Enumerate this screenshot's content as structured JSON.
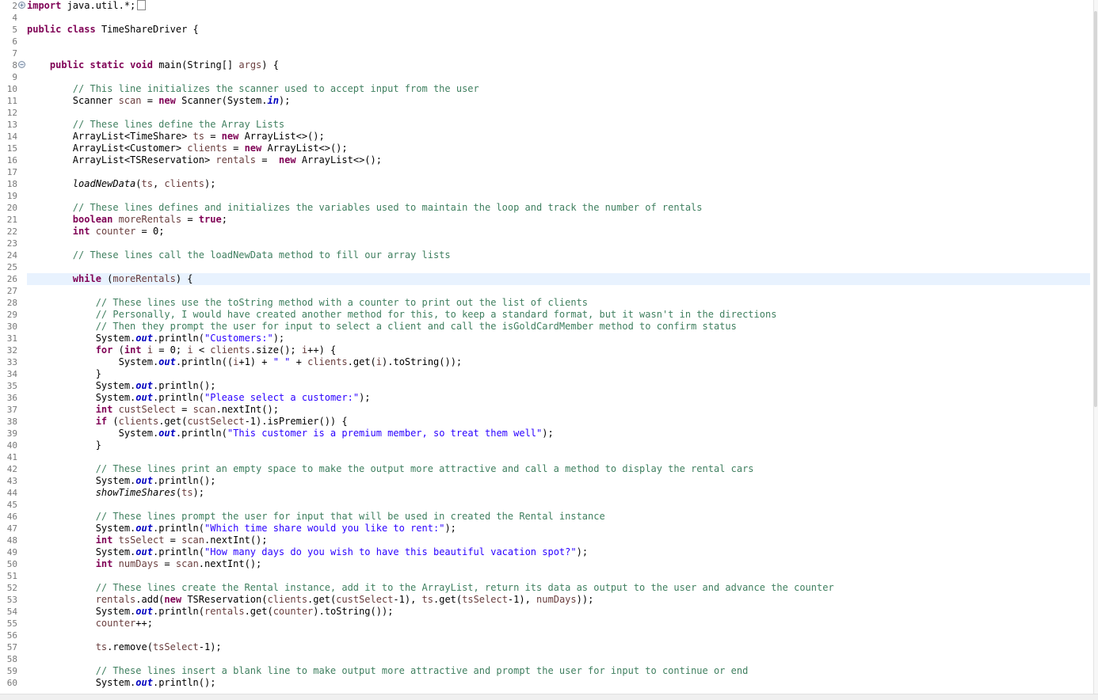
{
  "editor": {
    "lines": [
      {
        "n": "2",
        "fold": "+",
        "segs": [
          {
            "c": "kw",
            "t": "import"
          },
          {
            "t": " java.util.*;"
          }
        ],
        "box": true
      },
      {
        "n": "4",
        "segs": []
      },
      {
        "n": "5",
        "segs": [
          {
            "c": "kw",
            "t": "public"
          },
          {
            "t": " "
          },
          {
            "c": "kw",
            "t": "class"
          },
          {
            "t": " TimeShareDriver {"
          }
        ]
      },
      {
        "n": "6",
        "segs": []
      },
      {
        "n": "7",
        "segs": []
      },
      {
        "n": "8",
        "fold": "−",
        "segs": [
          {
            "t": "    "
          },
          {
            "c": "kw",
            "t": "public"
          },
          {
            "t": " "
          },
          {
            "c": "kw",
            "t": "static"
          },
          {
            "t": " "
          },
          {
            "c": "kw",
            "t": "void"
          },
          {
            "t": " main(String[] "
          },
          {
            "c": "var",
            "t": "args"
          },
          {
            "t": ") {"
          }
        ]
      },
      {
        "n": "9",
        "segs": []
      },
      {
        "n": "10",
        "segs": [
          {
            "t": "        "
          },
          {
            "c": "cm",
            "t": "// This line initializes the scanner used to accept input from the user"
          }
        ]
      },
      {
        "n": "11",
        "segs": [
          {
            "t": "        Scanner "
          },
          {
            "c": "var",
            "t": "scan"
          },
          {
            "t": " = "
          },
          {
            "c": "kw",
            "t": "new"
          },
          {
            "t": " Scanner(System."
          },
          {
            "c": "fld",
            "t": "in"
          },
          {
            "t": ");"
          }
        ]
      },
      {
        "n": "12",
        "segs": []
      },
      {
        "n": "13",
        "segs": [
          {
            "t": "        "
          },
          {
            "c": "cm",
            "t": "// These lines define the Array Lists"
          }
        ]
      },
      {
        "n": "14",
        "segs": [
          {
            "t": "        ArrayList<TimeShare> "
          },
          {
            "c": "var",
            "t": "ts"
          },
          {
            "t": " = "
          },
          {
            "c": "kw",
            "t": "new"
          },
          {
            "t": " ArrayList<>();"
          }
        ]
      },
      {
        "n": "15",
        "segs": [
          {
            "t": "        ArrayList<Customer> "
          },
          {
            "c": "var",
            "t": "clients"
          },
          {
            "t": " = "
          },
          {
            "c": "kw",
            "t": "new"
          },
          {
            "t": " ArrayList<>();"
          }
        ]
      },
      {
        "n": "16",
        "segs": [
          {
            "t": "        ArrayList<TSReservation> "
          },
          {
            "c": "var",
            "t": "rentals"
          },
          {
            "t": " =  "
          },
          {
            "c": "kw",
            "t": "new"
          },
          {
            "t": " ArrayList<>();"
          }
        ]
      },
      {
        "n": "17",
        "segs": []
      },
      {
        "n": "18",
        "segs": [
          {
            "t": "        "
          },
          {
            "c": "st",
            "t": "loadNewData"
          },
          {
            "t": "("
          },
          {
            "c": "var",
            "t": "ts"
          },
          {
            "t": ", "
          },
          {
            "c": "var",
            "t": "clients"
          },
          {
            "t": ");"
          }
        ]
      },
      {
        "n": "19",
        "segs": []
      },
      {
        "n": "20",
        "segs": [
          {
            "t": "        "
          },
          {
            "c": "cm",
            "t": "// These lines defines and initializes the variables used to maintain the loop and track the number of rentals"
          }
        ]
      },
      {
        "n": "21",
        "segs": [
          {
            "t": "        "
          },
          {
            "c": "kw",
            "t": "boolean"
          },
          {
            "t": " "
          },
          {
            "c": "var",
            "t": "moreRentals"
          },
          {
            "t": " = "
          },
          {
            "c": "kw",
            "t": "true"
          },
          {
            "t": ";"
          }
        ]
      },
      {
        "n": "22",
        "segs": [
          {
            "t": "        "
          },
          {
            "c": "kw",
            "t": "int"
          },
          {
            "t": " "
          },
          {
            "c": "var",
            "t": "counter"
          },
          {
            "t": " = 0;"
          }
        ]
      },
      {
        "n": "23",
        "segs": []
      },
      {
        "n": "24",
        "segs": [
          {
            "t": "        "
          },
          {
            "c": "cm",
            "t": "// These lines call the loadNewData method to fill our array lists"
          }
        ]
      },
      {
        "n": "25",
        "segs": []
      },
      {
        "n": "26",
        "cur": true,
        "segs": [
          {
            "t": "        "
          },
          {
            "c": "kw",
            "t": "while"
          },
          {
            "t": " ("
          },
          {
            "c": "var",
            "t": "moreRentals"
          },
          {
            "t": ") {"
          }
        ]
      },
      {
        "n": "27",
        "segs": []
      },
      {
        "n": "28",
        "segs": [
          {
            "t": "            "
          },
          {
            "c": "cm",
            "t": "// These lines use the toString method with a counter to print out the list of clients"
          }
        ]
      },
      {
        "n": "29",
        "segs": [
          {
            "t": "            "
          },
          {
            "c": "cm",
            "t": "// Personally, I would have created another method for this, to keep a standard format, but it wasn't in the directions"
          }
        ]
      },
      {
        "n": "30",
        "segs": [
          {
            "t": "            "
          },
          {
            "c": "cm",
            "t": "// Then they prompt the user for input to select a client and call the isGoldCardMember method to confirm status"
          }
        ]
      },
      {
        "n": "31",
        "segs": [
          {
            "t": "            System."
          },
          {
            "c": "fld",
            "t": "out"
          },
          {
            "t": ".println("
          },
          {
            "c": "str",
            "t": "\"Customers:\""
          },
          {
            "t": ");"
          }
        ]
      },
      {
        "n": "32",
        "segs": [
          {
            "t": "            "
          },
          {
            "c": "kw",
            "t": "for"
          },
          {
            "t": " ("
          },
          {
            "c": "kw",
            "t": "int"
          },
          {
            "t": " "
          },
          {
            "c": "var",
            "t": "i"
          },
          {
            "t": " = 0; "
          },
          {
            "c": "var",
            "t": "i"
          },
          {
            "t": " < "
          },
          {
            "c": "var",
            "t": "clients"
          },
          {
            "t": ".size(); "
          },
          {
            "c": "var",
            "t": "i"
          },
          {
            "t": "++) {"
          }
        ]
      },
      {
        "n": "33",
        "segs": [
          {
            "t": "                System."
          },
          {
            "c": "fld",
            "t": "out"
          },
          {
            "t": ".println(("
          },
          {
            "c": "var",
            "t": "i"
          },
          {
            "t": "+1) + "
          },
          {
            "c": "str",
            "t": "\" \""
          },
          {
            "t": " + "
          },
          {
            "c": "var",
            "t": "clients"
          },
          {
            "t": ".get("
          },
          {
            "c": "var",
            "t": "i"
          },
          {
            "t": ").toString());"
          }
        ]
      },
      {
        "n": "34",
        "segs": [
          {
            "t": "            }"
          }
        ]
      },
      {
        "n": "35",
        "segs": [
          {
            "t": "            System."
          },
          {
            "c": "fld",
            "t": "out"
          },
          {
            "t": ".println();"
          }
        ]
      },
      {
        "n": "36",
        "segs": [
          {
            "t": "            System."
          },
          {
            "c": "fld",
            "t": "out"
          },
          {
            "t": ".println("
          },
          {
            "c": "str",
            "t": "\"Please select a customer:\""
          },
          {
            "t": ");"
          }
        ]
      },
      {
        "n": "37",
        "segs": [
          {
            "t": "            "
          },
          {
            "c": "kw",
            "t": "int"
          },
          {
            "t": " "
          },
          {
            "c": "var",
            "t": "custSelect"
          },
          {
            "t": " = "
          },
          {
            "c": "var",
            "t": "scan"
          },
          {
            "t": ".nextInt();"
          }
        ]
      },
      {
        "n": "38",
        "segs": [
          {
            "t": "            "
          },
          {
            "c": "kw",
            "t": "if"
          },
          {
            "t": " ("
          },
          {
            "c": "var",
            "t": "clients"
          },
          {
            "t": ".get("
          },
          {
            "c": "var",
            "t": "custSelect"
          },
          {
            "t": "-1).isPremier()) {"
          }
        ]
      },
      {
        "n": "39",
        "segs": [
          {
            "t": "                System."
          },
          {
            "c": "fld",
            "t": "out"
          },
          {
            "t": ".println("
          },
          {
            "c": "str",
            "t": "\"This customer is a premium member, so treat them well\""
          },
          {
            "t": ");"
          }
        ]
      },
      {
        "n": "40",
        "segs": [
          {
            "t": "            }"
          }
        ]
      },
      {
        "n": "41",
        "segs": []
      },
      {
        "n": "42",
        "segs": [
          {
            "t": "            "
          },
          {
            "c": "cm",
            "t": "// These lines print an empty space to make the output more attractive and call a method to display the rental cars"
          }
        ]
      },
      {
        "n": "43",
        "segs": [
          {
            "t": "            System."
          },
          {
            "c": "fld",
            "t": "out"
          },
          {
            "t": ".println();"
          }
        ]
      },
      {
        "n": "44",
        "segs": [
          {
            "t": "            "
          },
          {
            "c": "st",
            "t": "showTimeShares"
          },
          {
            "t": "("
          },
          {
            "c": "var",
            "t": "ts"
          },
          {
            "t": ");"
          }
        ]
      },
      {
        "n": "45",
        "segs": []
      },
      {
        "n": "46",
        "segs": [
          {
            "t": "            "
          },
          {
            "c": "cm",
            "t": "// These lines prompt the user for input that will be used in created the Rental instance"
          }
        ]
      },
      {
        "n": "47",
        "segs": [
          {
            "t": "            System."
          },
          {
            "c": "fld",
            "t": "out"
          },
          {
            "t": ".println("
          },
          {
            "c": "str",
            "t": "\"Which time share would you like to rent:\""
          },
          {
            "t": ");"
          }
        ]
      },
      {
        "n": "48",
        "segs": [
          {
            "t": "            "
          },
          {
            "c": "kw",
            "t": "int"
          },
          {
            "t": " "
          },
          {
            "c": "var",
            "t": "tsSelect"
          },
          {
            "t": " = "
          },
          {
            "c": "var",
            "t": "scan"
          },
          {
            "t": ".nextInt();"
          }
        ]
      },
      {
        "n": "49",
        "segs": [
          {
            "t": "            System."
          },
          {
            "c": "fld",
            "t": "out"
          },
          {
            "t": ".println("
          },
          {
            "c": "str",
            "t": "\"How many days do you wish to have this beautiful vacation spot?\""
          },
          {
            "t": ");"
          }
        ]
      },
      {
        "n": "50",
        "segs": [
          {
            "t": "            "
          },
          {
            "c": "kw",
            "t": "int"
          },
          {
            "t": " "
          },
          {
            "c": "var",
            "t": "numDays"
          },
          {
            "t": " = "
          },
          {
            "c": "var",
            "t": "scan"
          },
          {
            "t": ".nextInt();"
          }
        ]
      },
      {
        "n": "51",
        "segs": []
      },
      {
        "n": "52",
        "segs": [
          {
            "t": "            "
          },
          {
            "c": "cm",
            "t": "// These lines create the Rental instance, add it to the ArrayList, return its data as output to the user and advance the counter"
          }
        ]
      },
      {
        "n": "53",
        "segs": [
          {
            "t": "            "
          },
          {
            "c": "var",
            "t": "rentals"
          },
          {
            "t": ".add("
          },
          {
            "c": "kw",
            "t": "new"
          },
          {
            "t": " TSReservation("
          },
          {
            "c": "var",
            "t": "clients"
          },
          {
            "t": ".get("
          },
          {
            "c": "var",
            "t": "custSelect"
          },
          {
            "t": "-1), "
          },
          {
            "c": "var",
            "t": "ts"
          },
          {
            "t": ".get("
          },
          {
            "c": "var",
            "t": "tsSelect"
          },
          {
            "t": "-1), "
          },
          {
            "c": "var",
            "t": "numDays"
          },
          {
            "t": "));"
          }
        ]
      },
      {
        "n": "54",
        "segs": [
          {
            "t": "            System."
          },
          {
            "c": "fld",
            "t": "out"
          },
          {
            "t": ".println("
          },
          {
            "c": "var",
            "t": "rentals"
          },
          {
            "t": ".get("
          },
          {
            "c": "var",
            "t": "counter"
          },
          {
            "t": ").toString());"
          }
        ]
      },
      {
        "n": "55",
        "segs": [
          {
            "t": "            "
          },
          {
            "c": "var",
            "t": "counter"
          },
          {
            "t": "++;"
          }
        ]
      },
      {
        "n": "56",
        "segs": []
      },
      {
        "n": "57",
        "segs": [
          {
            "t": "            "
          },
          {
            "c": "var",
            "t": "ts"
          },
          {
            "t": ".remove("
          },
          {
            "c": "var",
            "t": "tsSelect"
          },
          {
            "t": "-1);"
          }
        ]
      },
      {
        "n": "58",
        "segs": []
      },
      {
        "n": "59",
        "segs": [
          {
            "t": "            "
          },
          {
            "c": "cm",
            "t": "// These lines insert a blank line to make output more attractive and prompt the user for input to continue or end"
          }
        ]
      },
      {
        "n": "60",
        "segs": [
          {
            "t": "            System."
          },
          {
            "c": "fld",
            "t": "out"
          },
          {
            "t": ".println();"
          }
        ]
      }
    ]
  }
}
